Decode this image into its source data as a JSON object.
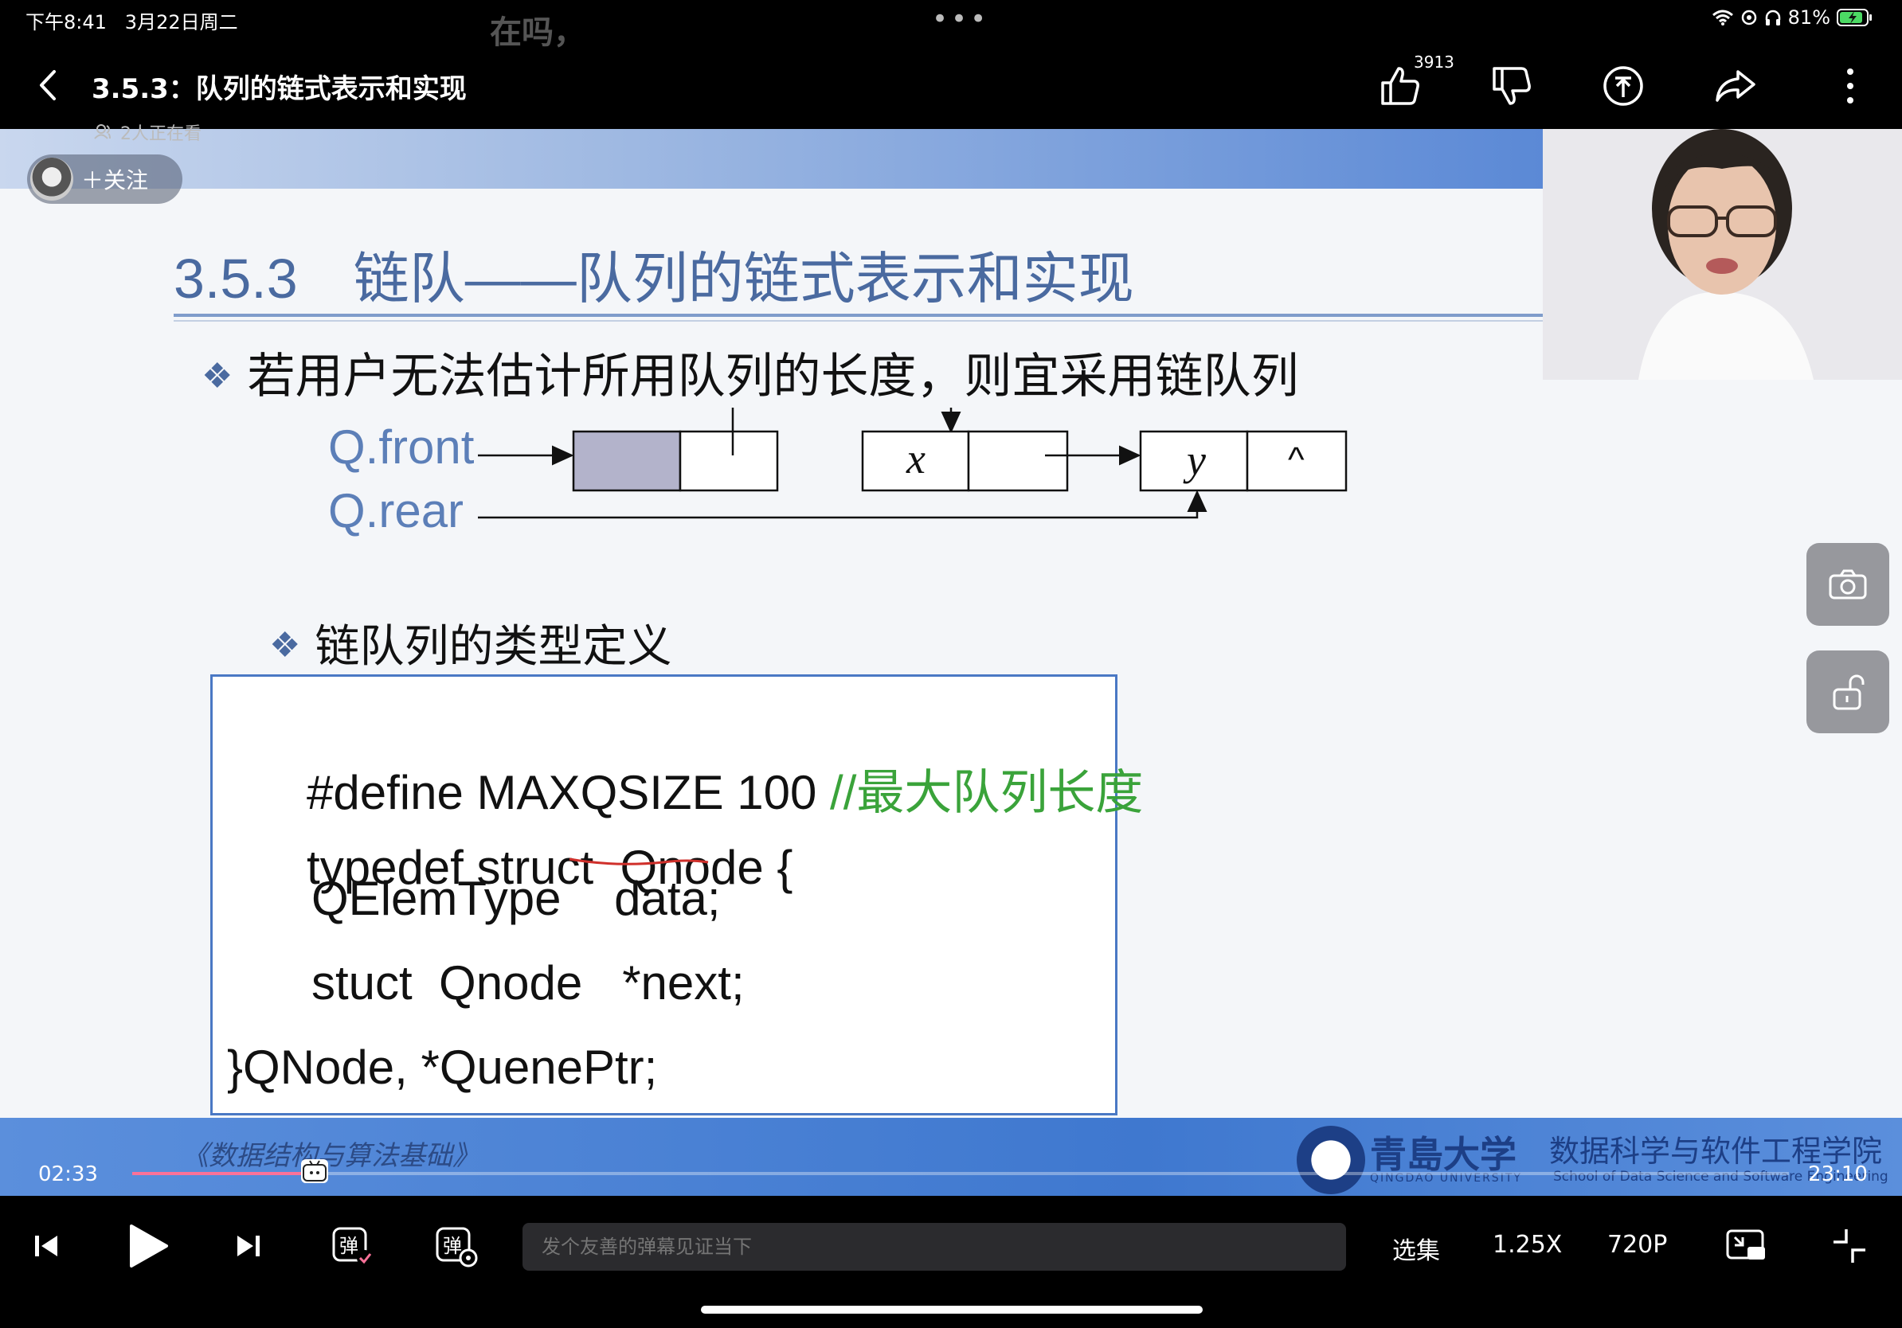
{
  "status_bar": {
    "time": "下午8:41",
    "date": "3月22日周二",
    "battery": "81%",
    "floating_comment": "在吗，"
  },
  "header": {
    "title": "3.5.3：队列的链式表示和实现",
    "viewers": "2人正在看",
    "like_count": "3913",
    "follow_label": "＋关注"
  },
  "slide": {
    "title": "3.5.3　链队——队列的链式表示和实现",
    "bullet1": "若用户无法估计所用队列的长度，则宜采用链队列",
    "bullet2": "链队列的类型定义",
    "diagram": {
      "front_label": "Q.front",
      "rear_label": "Q.rear",
      "node1": "x",
      "node2": "y",
      "null_symbol": "^"
    },
    "code": {
      "line1": "#define MAXQSIZE 100 ",
      "line1_comment": "//最大队列长度",
      "line2_a": "typedef struct  ",
      "line2_b": "Qnode",
      "line2_c": " {",
      "line3": "QElemType    data;",
      "line4": "stuct  Qnode   *next;",
      "line5": "}QNode, *QuenePtr;"
    },
    "course_name": "《数据结构与算法基础》",
    "university_cn": "青島大学",
    "university_en": "QINGDAO UNIVERSITY",
    "school_cn": "数据科学与软件工程学院",
    "school_en": "School of Data Science and Software Engineering"
  },
  "player": {
    "current_time": "02:33",
    "total_time": "23:10",
    "progress": 0.11,
    "danmaku_placeholder": "发个友善的弹幕见证当下",
    "episodes_label": "选集",
    "speed_label": "1.25X",
    "quality_label": "720P"
  },
  "colors": {
    "accent_pink": "#fb7299",
    "slide_blue": "#4a6aa0",
    "comment_green": "#3aa33a"
  }
}
